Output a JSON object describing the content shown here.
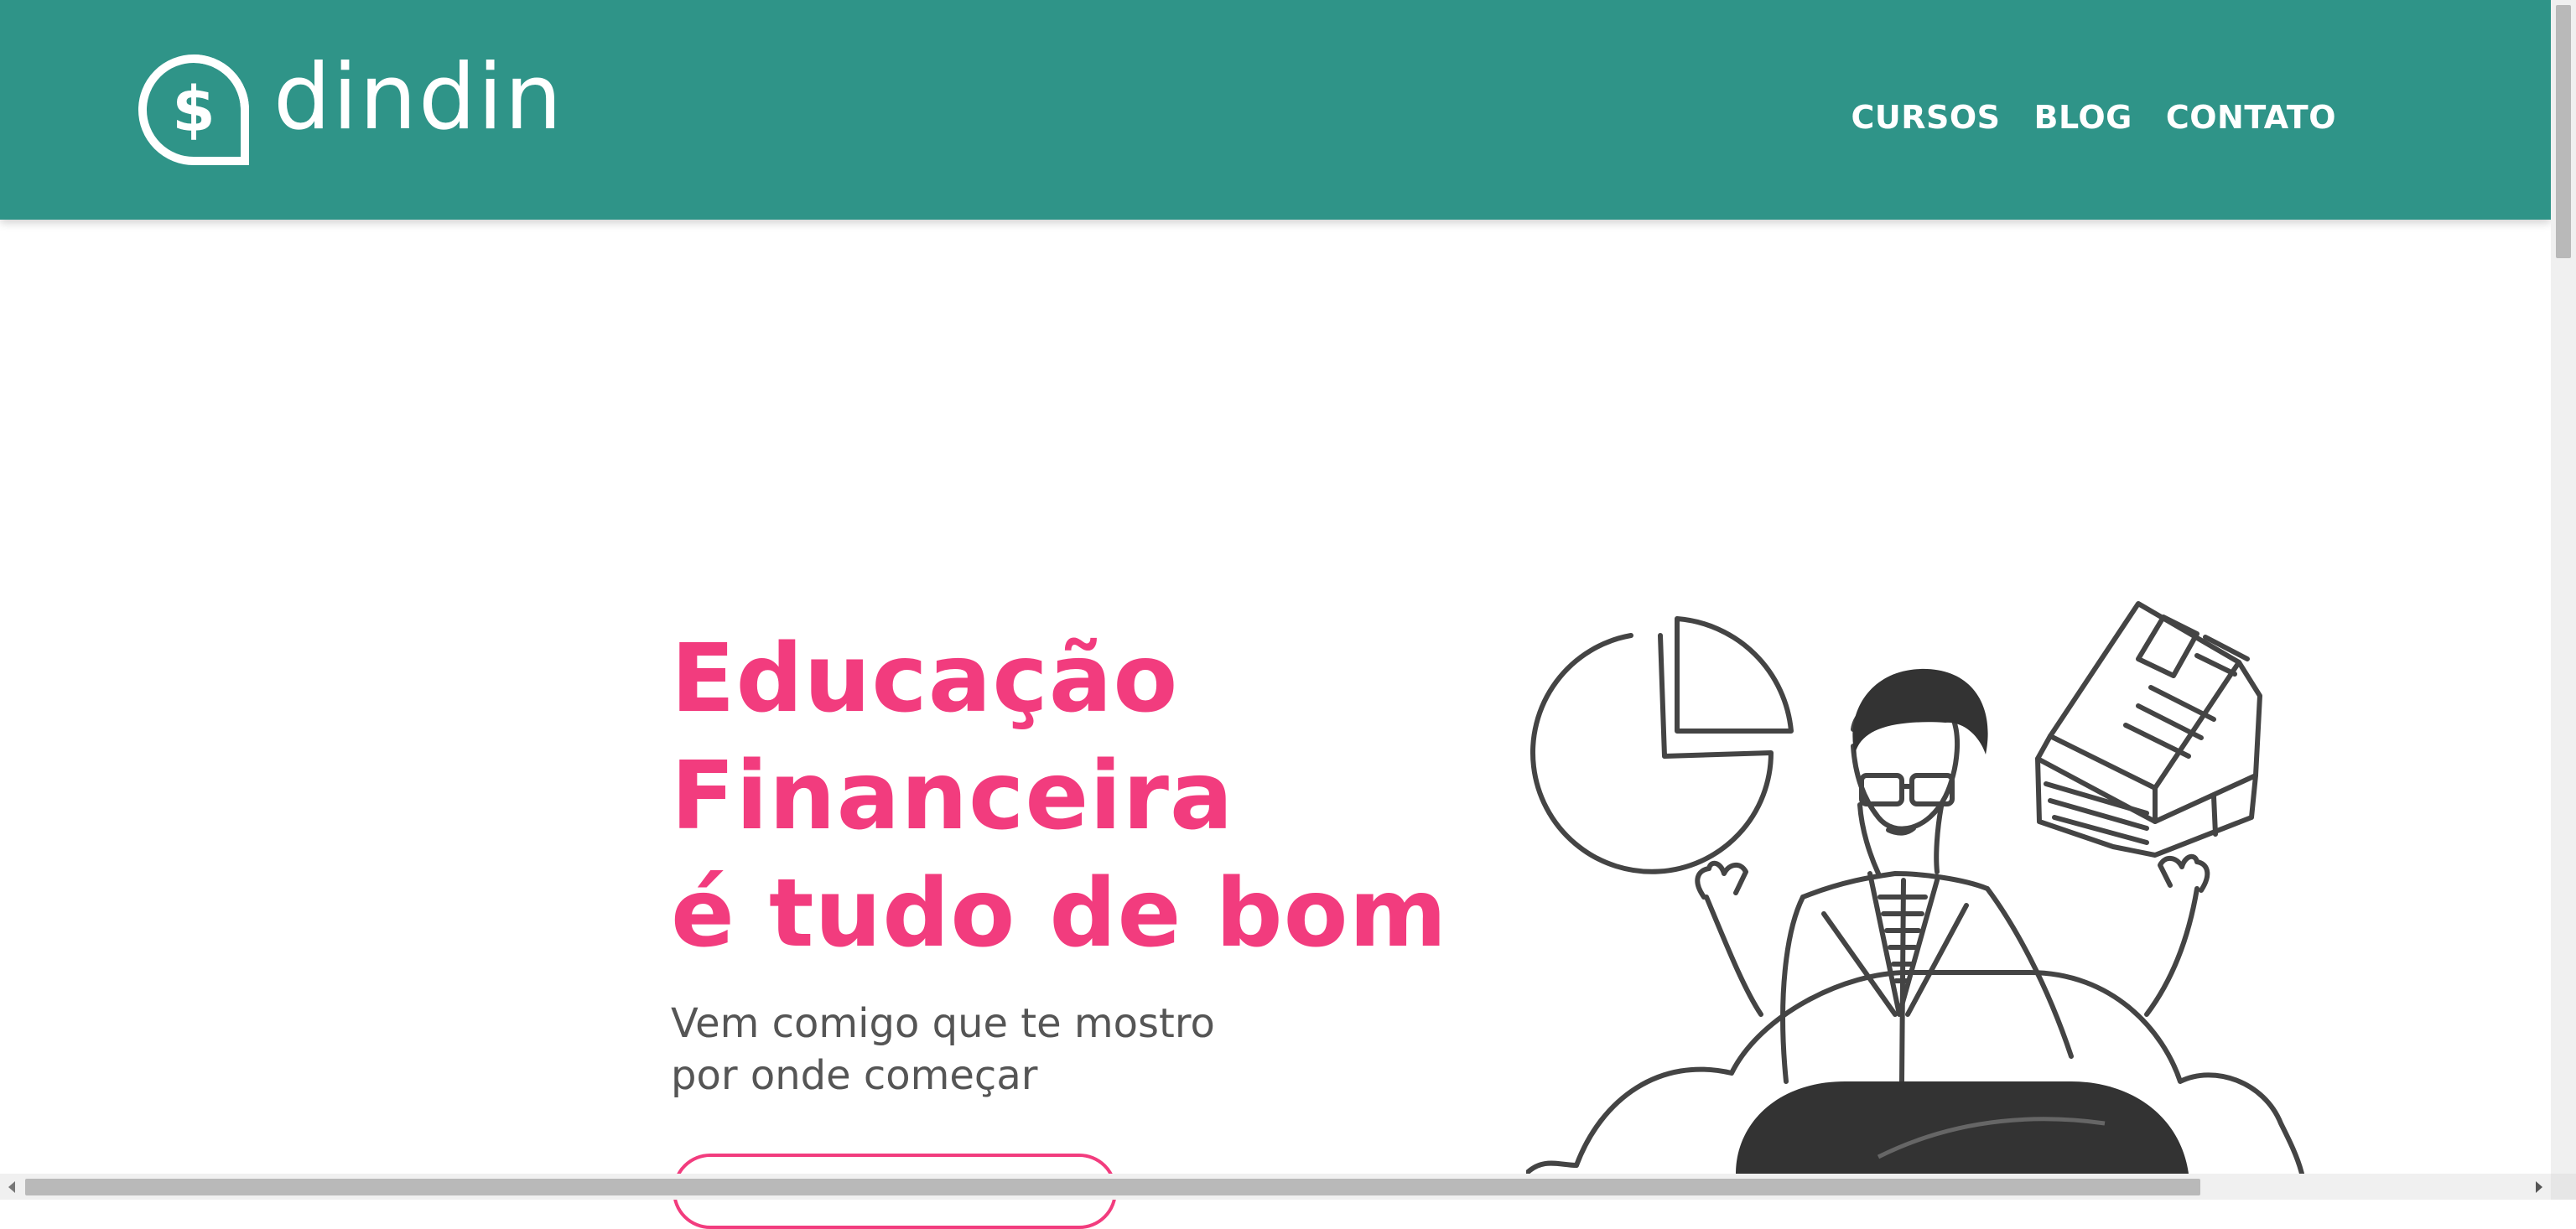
{
  "brand": {
    "name": "dindin",
    "color": "#2f9488"
  },
  "nav": {
    "items": [
      {
        "label": "CURSOS"
      },
      {
        "label": "BLOG"
      },
      {
        "label": "CONTATO"
      }
    ]
  },
  "hero": {
    "title_lines": [
      "Educação",
      "Financeira",
      "é tudo de bom"
    ],
    "subtitle_lines": [
      "Vem comigo que te mostro",
      "por onde começar"
    ],
    "accent_color": "#f23c7e"
  },
  "illustration": {
    "icon": "meditating-person-with-chart-and-documents"
  }
}
